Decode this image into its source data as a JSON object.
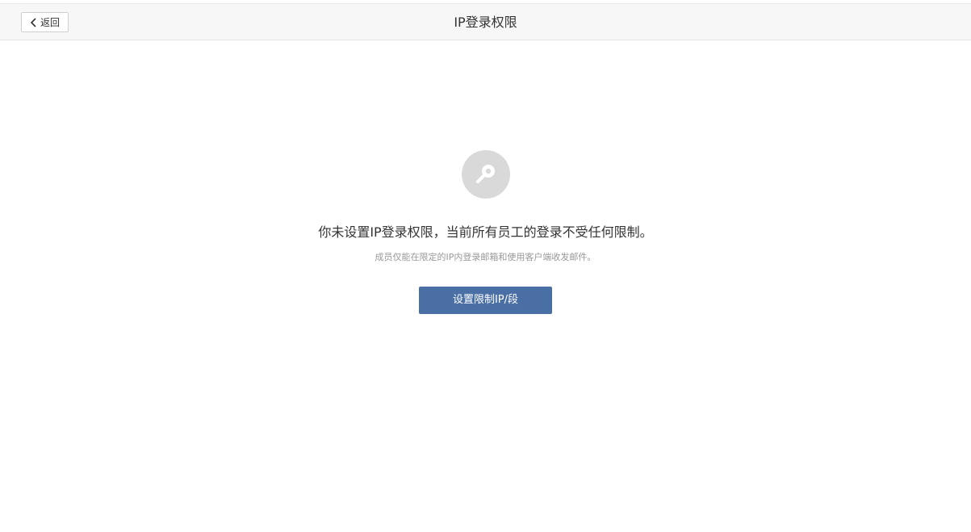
{
  "header": {
    "back_label": "返回",
    "title": "IP登录权限"
  },
  "empty_state": {
    "icon": "key-icon",
    "headline": "你未设置IP登录权限，当前所有员工的登录不受任何限制。",
    "description": "成员仅能在限定的IP内登录邮箱和使用客户端收发邮件。",
    "action_label": "设置限制IP/段"
  },
  "colors": {
    "primary_button": "#4a6fa5",
    "icon_circle": "#d9d9d9",
    "header_bg": "#f7f7f7"
  }
}
